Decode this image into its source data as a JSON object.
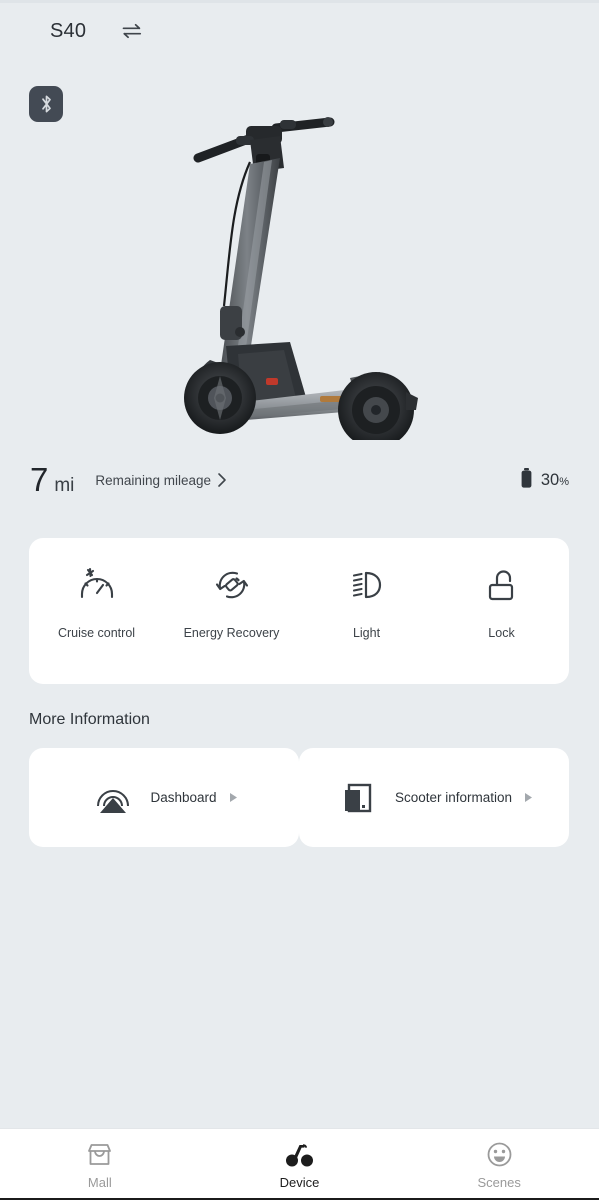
{
  "header": {
    "device_name": "S40",
    "swap_icon": "switch-device-icon",
    "bluetooth_icon": "bluetooth-icon"
  },
  "hero": {
    "image_name": "electric-scooter-product-image"
  },
  "status": {
    "mileage_value": "7",
    "mileage_unit": "mi",
    "mileage_label": "Remaining mileage",
    "mileage_chevron": "chevron-right-icon",
    "battery_icon": "battery-icon",
    "battery_percent": "30",
    "battery_percent_symbol": "%"
  },
  "controls": [
    {
      "label": "Cruise control",
      "icon": "speedometer-icon"
    },
    {
      "label": "Energy Recovery",
      "icon": "energy-recovery-icon"
    },
    {
      "label": "Light",
      "icon": "headlight-icon"
    },
    {
      "label": "Lock",
      "icon": "unlocked-padlock-icon"
    }
  ],
  "more_information": {
    "title": "More Information",
    "cards": [
      {
        "label": "Dashboard",
        "icon": "dashboard-gauge-icon",
        "arrow": "triangle-right-icon"
      },
      {
        "label": "Scooter information",
        "icon": "scooter-info-icon",
        "arrow": "triangle-right-icon"
      }
    ]
  },
  "tabbar": {
    "items": [
      {
        "label": "Mall",
        "icon": "store-icon",
        "active": false
      },
      {
        "label": "Device",
        "icon": "scooter-icon",
        "active": true
      },
      {
        "label": "Scenes",
        "icon": "smiley-face-icon",
        "active": false
      }
    ]
  },
  "colors": {
    "background": "#e8ecef",
    "card": "#ffffff",
    "text_primary": "#2f353b",
    "chip_dark": "#434a54",
    "tab_active": "#1d1d1d",
    "tab_inactive": "#9a9a9a"
  }
}
